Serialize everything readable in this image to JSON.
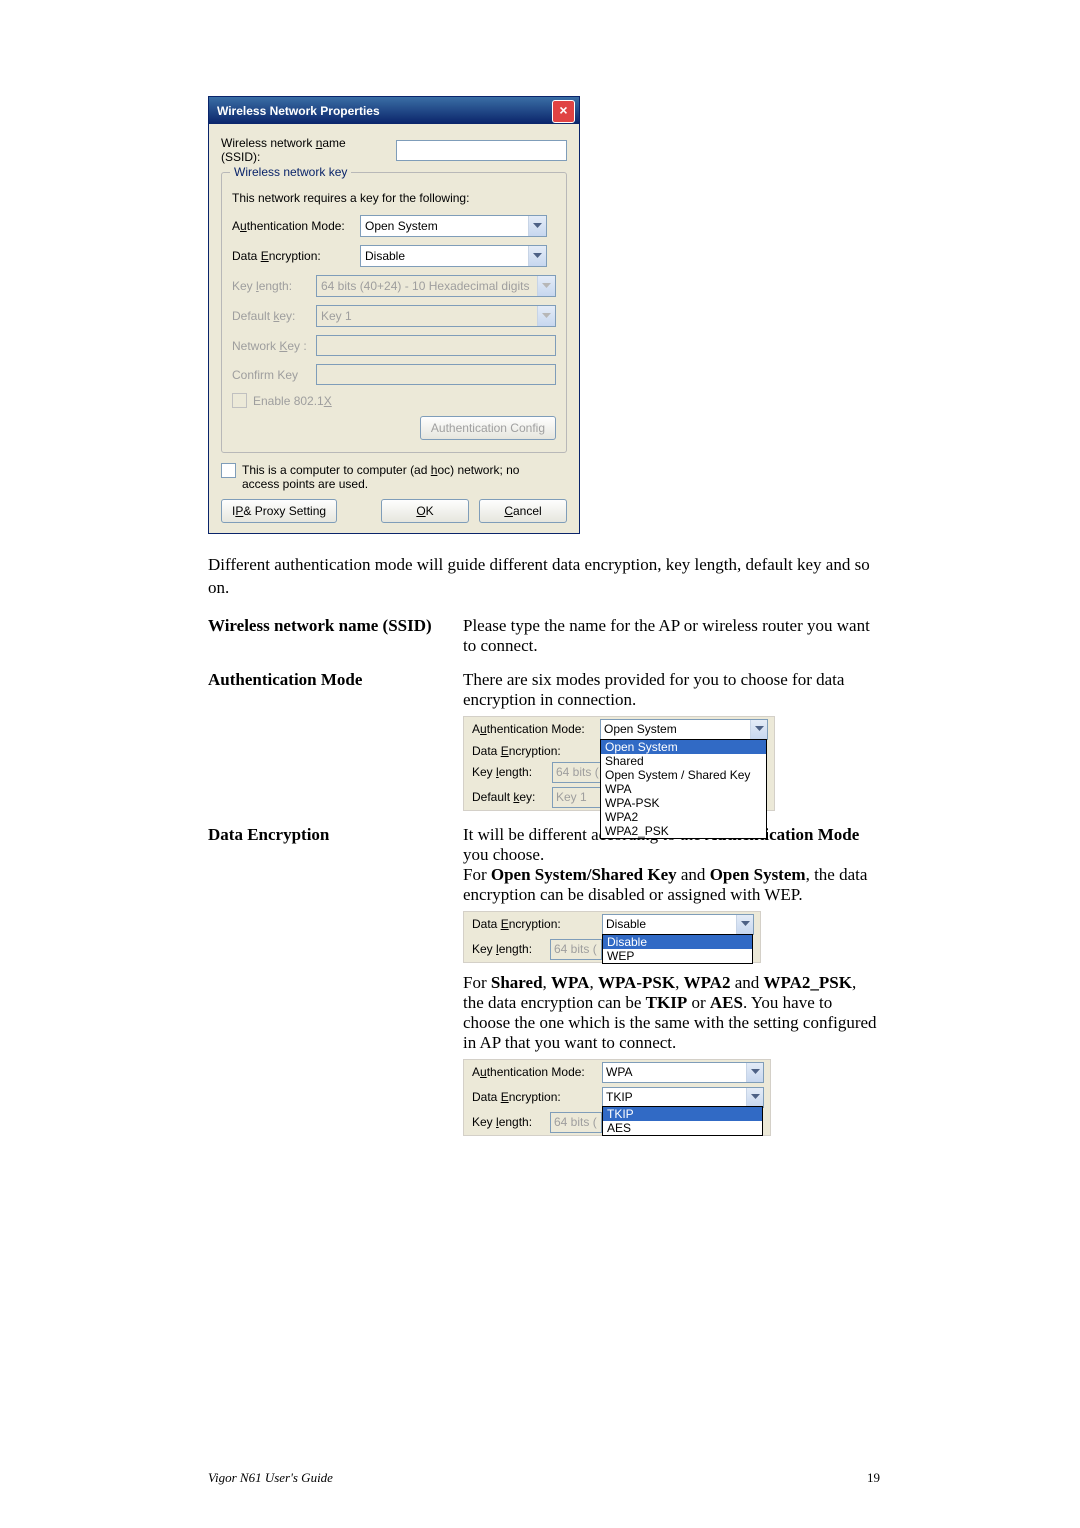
{
  "dialog": {
    "title": "Wireless Network Properties",
    "ssid_label_pre": "Wireless network ",
    "ssid_label_u": "n",
    "ssid_label_post": "ame (SSID):",
    "ssid_value": "",
    "group_legend": "Wireless network key",
    "group_intro": "This network requires a key for the following:",
    "auth_label_pre": "A",
    "auth_label_u": "u",
    "auth_label_post": "thentication Mode:",
    "auth_value": "Open System",
    "enc_label_pre": "Data ",
    "enc_label_u": "E",
    "enc_label_post": "ncryption:",
    "enc_value": "Disable",
    "keylen_label_pre": "Key ",
    "keylen_label_u": "l",
    "keylen_label_post": "ength:",
    "keylen_value": "64 bits (40+24) - 10 Hexadecimal digits",
    "defkey_label_pre": "Default ",
    "defkey_label_u": "k",
    "defkey_label_post": "ey:",
    "defkey_value": "Key 1",
    "netkey_label_pre": "Network ",
    "netkey_label_u": "K",
    "netkey_label_post": "ey :",
    "confirm_label": "Confirm Key",
    "enable8021x_pre": "Enable 802.1",
    "enable8021x_u": "X",
    "authconfig_btn": "Authentication Config",
    "adhoc_pre": "This is a computer to computer (ad ",
    "adhoc_u": "h",
    "adhoc_post": "oc) network; no access points are used.",
    "ipproxy_pre": "I",
    "ipproxy_u": "P",
    "ipproxy_post": " & Proxy Setting",
    "ok_u": "O",
    "ok_post": "K",
    "cancel_u": "C",
    "cancel_post": "ancel"
  },
  "body": {
    "para1": "Different authentication mode will guide different data encryption, key length, default key and so on.",
    "term_ssid": "Wireless network name (SSID)",
    "desc_ssid": "Please type the name for the AP or wireless router you want to connect.",
    "term_auth": "Authentication Mode",
    "desc_auth": "There are six modes provided for you to choose for data encryption in connection.",
    "term_enc": "Data Encryption",
    "desc_enc_1a": "It will be different according to the ",
    "desc_enc_1b": "Authentication Mode",
    "desc_enc_1c": " you choose.",
    "desc_enc_2a": "For ",
    "desc_enc_2b": "Open System/Shared Key",
    "desc_enc_2c": " and ",
    "desc_enc_2d": "Open System",
    "desc_enc_2e": ", the data encryption can be disabled or assigned with WEP.",
    "desc_enc_3a": "For ",
    "desc_enc_3b": "Shared",
    "desc_enc_3c": ", ",
    "desc_enc_3d": "WPA",
    "desc_enc_3e": ", ",
    "desc_enc_3f": "WPA-PSK",
    "desc_enc_3g": ", ",
    "desc_enc_3h": "WPA2",
    "desc_enc_3i": " and ",
    "desc_enc_3j": "WPA2_PSK",
    "desc_enc_3k": ", the data encryption can be ",
    "desc_enc_3l": "TKIP",
    "desc_enc_3m": " or ",
    "desc_enc_3n": "AES",
    "desc_enc_3o": ". You have to choose the one which is the same with the setting configured in AP that you want to connect."
  },
  "fig_auth": {
    "labels": {
      "auth_pre": "A",
      "auth_u": "u",
      "auth_post": "thentication Mode:",
      "enc_pre": "Data ",
      "enc_u": "E",
      "enc_post": "ncryption:",
      "keylen_pre": "Key ",
      "keylen_u": "l",
      "keylen_post": "ength:",
      "defkey_pre": "Default ",
      "defkey_u": "k",
      "defkey_post": "ey:"
    },
    "combo_auth": "Open System",
    "keylen_value": "64 bits (",
    "defkey_value": "Key 1",
    "options": [
      "Open System",
      "Shared",
      "Open System / Shared Key",
      "WPA",
      "WPA-PSK",
      "WPA2",
      "WPA2_PSK"
    ]
  },
  "fig_enc1": {
    "enc_pre": "Data ",
    "enc_u": "E",
    "enc_post": "ncryption:",
    "enc_value": "Disable",
    "keylen_pre": "Key ",
    "keylen_u": "l",
    "keylen_post": "ength:",
    "keylen_value": "64 bits (",
    "options": [
      "Disable",
      "WEP"
    ]
  },
  "fig_enc2": {
    "auth_pre": "A",
    "auth_u": "u",
    "auth_post": "thentication Mode:",
    "auth_value": "WPA",
    "enc_pre": "Data ",
    "enc_u": "E",
    "enc_post": "ncryption:",
    "enc_value": "TKIP",
    "keylen_pre": "Key ",
    "keylen_u": "l",
    "keylen_post": "ength:",
    "keylen_value": "64 bits (",
    "options": [
      "TKIP",
      "AES"
    ]
  },
  "footer": {
    "left": "Vigor N61 User's Guide",
    "right": "19"
  }
}
